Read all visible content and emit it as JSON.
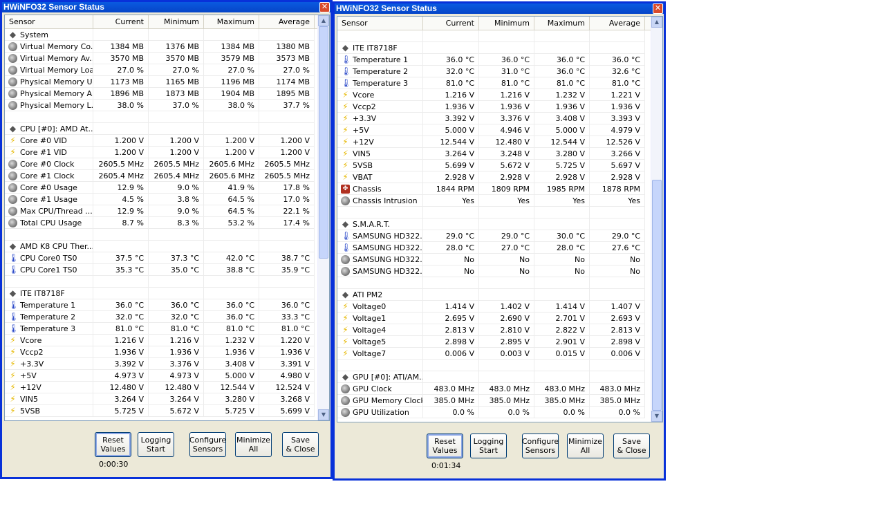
{
  "columns": [
    "Sensor",
    "Current",
    "Minimum",
    "Maximum",
    "Average"
  ],
  "buttons": [
    {
      "line1": "Reset",
      "line2": "Values"
    },
    {
      "line1": "Logging",
      "line2": "Start"
    },
    {
      "line1": "Configure",
      "line2": "Sensors"
    },
    {
      "line1": "Minimize",
      "line2": "All"
    },
    {
      "line1": "Save",
      "line2": "& Close"
    }
  ],
  "windows": [
    {
      "title": "HWiNFO32 Sensor Status",
      "timer": "0:00:30",
      "rows": [
        {
          "icon": "chip",
          "name": "System",
          "vals": [
            "",
            "",
            "",
            ""
          ]
        },
        {
          "icon": "clock",
          "name": "Virtual Memory Co...",
          "vals": [
            "1384 MB",
            "1376 MB",
            "1384 MB",
            "1380 MB"
          ]
        },
        {
          "icon": "clock",
          "name": "Virtual Memory Av...",
          "vals": [
            "3570 MB",
            "3570 MB",
            "3579 MB",
            "3573 MB"
          ]
        },
        {
          "icon": "clock",
          "name": "Virtual Memory Load",
          "vals": [
            "27.0 %",
            "27.0 %",
            "27.0 %",
            "27.0 %"
          ]
        },
        {
          "icon": "clock",
          "name": "Physical Memory U...",
          "vals": [
            "1173 MB",
            "1165 MB",
            "1196 MB",
            "1174 MB"
          ]
        },
        {
          "icon": "clock",
          "name": "Physical Memory A...",
          "vals": [
            "1896 MB",
            "1873 MB",
            "1904 MB",
            "1895 MB"
          ]
        },
        {
          "icon": "clock",
          "name": "Physical Memory L...",
          "vals": [
            "38.0 %",
            "37.0 %",
            "38.0 %",
            "37.7 %"
          ]
        },
        {
          "icon": "",
          "name": "",
          "vals": [
            "",
            "",
            "",
            ""
          ]
        },
        {
          "icon": "chip",
          "name": "CPU [#0]: AMD At...",
          "vals": [
            "",
            "",
            "",
            ""
          ]
        },
        {
          "icon": "volt",
          "name": "Core #0 VID",
          "vals": [
            "1.200 V",
            "1.200 V",
            "1.200 V",
            "1.200 V"
          ]
        },
        {
          "icon": "volt",
          "name": "Core #1 VID",
          "vals": [
            "1.200 V",
            "1.200 V",
            "1.200 V",
            "1.200 V"
          ]
        },
        {
          "icon": "clock",
          "name": "Core #0 Clock",
          "vals": [
            "2605.5 MHz",
            "2605.5 MHz",
            "2605.6 MHz",
            "2605.5 MHz"
          ]
        },
        {
          "icon": "clock",
          "name": "Core #1 Clock",
          "vals": [
            "2605.4 MHz",
            "2605.4 MHz",
            "2605.6 MHz",
            "2605.5 MHz"
          ]
        },
        {
          "icon": "clock",
          "name": "Core #0 Usage",
          "vals": [
            "12.9 %",
            "9.0 %",
            "41.9 %",
            "17.8 %"
          ]
        },
        {
          "icon": "clock",
          "name": "Core #1 Usage",
          "vals": [
            "4.5 %",
            "3.8 %",
            "64.5 %",
            "17.0 %"
          ]
        },
        {
          "icon": "clock",
          "name": "Max CPU/Thread ...",
          "vals": [
            "12.9 %",
            "9.0 %",
            "64.5 %",
            "22.1 %"
          ]
        },
        {
          "icon": "clock",
          "name": "Total CPU Usage",
          "vals": [
            "8.7 %",
            "8.3 %",
            "53.2 %",
            "17.4 %"
          ]
        },
        {
          "icon": "",
          "name": "",
          "vals": [
            "",
            "",
            "",
            ""
          ]
        },
        {
          "icon": "chip",
          "name": "AMD K8 CPU Ther...",
          "vals": [
            "",
            "",
            "",
            ""
          ]
        },
        {
          "icon": "temp",
          "name": "CPU Core0 TS0",
          "vals": [
            "37.5 °C",
            "37.3 °C",
            "42.0 °C",
            "38.7 °C"
          ]
        },
        {
          "icon": "temp",
          "name": "CPU Core1 TS0",
          "vals": [
            "35.3 °C",
            "35.0 °C",
            "38.8 °C",
            "35.9 °C"
          ]
        },
        {
          "icon": "",
          "name": "",
          "vals": [
            "",
            "",
            "",
            ""
          ]
        },
        {
          "icon": "chip",
          "name": "ITE IT8718F",
          "vals": [
            "",
            "",
            "",
            ""
          ]
        },
        {
          "icon": "temp",
          "name": "Temperature 1",
          "vals": [
            "36.0 °C",
            "36.0 °C",
            "36.0 °C",
            "36.0 °C"
          ]
        },
        {
          "icon": "temp",
          "name": "Temperature 2",
          "vals": [
            "32.0 °C",
            "32.0 °C",
            "36.0 °C",
            "33.3 °C"
          ]
        },
        {
          "icon": "temp",
          "name": "Temperature 3",
          "vals": [
            "81.0 °C",
            "81.0 °C",
            "81.0 °C",
            "81.0 °C"
          ]
        },
        {
          "icon": "volt",
          "name": "Vcore",
          "vals": [
            "1.216 V",
            "1.216 V",
            "1.232 V",
            "1.220 V"
          ]
        },
        {
          "icon": "volt",
          "name": "Vccp2",
          "vals": [
            "1.936 V",
            "1.936 V",
            "1.936 V",
            "1.936 V"
          ]
        },
        {
          "icon": "volt",
          "name": "+3.3V",
          "vals": [
            "3.392 V",
            "3.376 V",
            "3.408 V",
            "3.391 V"
          ]
        },
        {
          "icon": "volt",
          "name": "+5V",
          "vals": [
            "4.973 V",
            "4.973 V",
            "5.000 V",
            "4.980 V"
          ]
        },
        {
          "icon": "volt",
          "name": "+12V",
          "vals": [
            "12.480 V",
            "12.480 V",
            "12.544 V",
            "12.524 V"
          ]
        },
        {
          "icon": "volt",
          "name": "VIN5",
          "vals": [
            "3.264 V",
            "3.264 V",
            "3.280 V",
            "3.268 V"
          ]
        },
        {
          "icon": "volt",
          "name": "5VSB",
          "vals": [
            "5.725 V",
            "5.672 V",
            "5.725 V",
            "5.699 V"
          ]
        }
      ]
    },
    {
      "title": "HWiNFO32 Sensor Status",
      "timer": "0:01:34",
      "rows": [
        {
          "icon": "",
          "name": "",
          "vals": [
            "",
            "",
            "",
            ""
          ]
        },
        {
          "icon": "chip",
          "name": "ITE IT8718F",
          "vals": [
            "",
            "",
            "",
            ""
          ]
        },
        {
          "icon": "temp",
          "name": "Temperature 1",
          "vals": [
            "36.0 °C",
            "36.0 °C",
            "36.0 °C",
            "36.0 °C"
          ]
        },
        {
          "icon": "temp",
          "name": "Temperature 2",
          "vals": [
            "32.0 °C",
            "31.0 °C",
            "36.0 °C",
            "32.6 °C"
          ]
        },
        {
          "icon": "temp",
          "name": "Temperature 3",
          "vals": [
            "81.0 °C",
            "81.0 °C",
            "81.0 °C",
            "81.0 °C"
          ]
        },
        {
          "icon": "volt",
          "name": "Vcore",
          "vals": [
            "1.216 V",
            "1.216 V",
            "1.232 V",
            "1.221 V"
          ]
        },
        {
          "icon": "volt",
          "name": "Vccp2",
          "vals": [
            "1.936 V",
            "1.936 V",
            "1.936 V",
            "1.936 V"
          ]
        },
        {
          "icon": "volt",
          "name": "+3.3V",
          "vals": [
            "3.392 V",
            "3.376 V",
            "3.408 V",
            "3.393 V"
          ]
        },
        {
          "icon": "volt",
          "name": "+5V",
          "vals": [
            "5.000 V",
            "4.946 V",
            "5.000 V",
            "4.979 V"
          ]
        },
        {
          "icon": "volt",
          "name": "+12V",
          "vals": [
            "12.544 V",
            "12.480 V",
            "12.544 V",
            "12.526 V"
          ]
        },
        {
          "icon": "volt",
          "name": "VIN5",
          "vals": [
            "3.264 V",
            "3.248 V",
            "3.280 V",
            "3.266 V"
          ]
        },
        {
          "icon": "volt",
          "name": "5VSB",
          "vals": [
            "5.699 V",
            "5.672 V",
            "5.725 V",
            "5.697 V"
          ]
        },
        {
          "icon": "volt",
          "name": "VBAT",
          "vals": [
            "2.928 V",
            "2.928 V",
            "2.928 V",
            "2.928 V"
          ]
        },
        {
          "icon": "fan",
          "name": "Chassis",
          "vals": [
            "1844 RPM",
            "1809 RPM",
            "1985 RPM",
            "1878 RPM"
          ]
        },
        {
          "icon": "clock",
          "name": "Chassis Intrusion",
          "vals": [
            "Yes",
            "Yes",
            "Yes",
            "Yes"
          ]
        },
        {
          "icon": "",
          "name": "",
          "vals": [
            "",
            "",
            "",
            ""
          ]
        },
        {
          "icon": "chip",
          "name": "S.M.A.R.T.",
          "vals": [
            "",
            "",
            "",
            ""
          ]
        },
        {
          "icon": "temp",
          "name": "SAMSUNG HD322...",
          "vals": [
            "29.0 °C",
            "29.0 °C",
            "30.0 °C",
            "29.0 °C"
          ]
        },
        {
          "icon": "temp",
          "name": "SAMSUNG HD322...",
          "vals": [
            "28.0 °C",
            "27.0 °C",
            "28.0 °C",
            "27.6 °C"
          ]
        },
        {
          "icon": "clock",
          "name": "SAMSUNG HD322...",
          "vals": [
            "No",
            "No",
            "No",
            "No"
          ]
        },
        {
          "icon": "clock",
          "name": "SAMSUNG HD322...",
          "vals": [
            "No",
            "No",
            "No",
            "No"
          ]
        },
        {
          "icon": "",
          "name": "",
          "vals": [
            "",
            "",
            "",
            ""
          ]
        },
        {
          "icon": "chip",
          "name": "ATI PM2",
          "vals": [
            "",
            "",
            "",
            ""
          ]
        },
        {
          "icon": "volt",
          "name": "Voltage0",
          "vals": [
            "1.414 V",
            "1.402 V",
            "1.414 V",
            "1.407 V"
          ]
        },
        {
          "icon": "volt",
          "name": "Voltage1",
          "vals": [
            "2.695 V",
            "2.690 V",
            "2.701 V",
            "2.693 V"
          ]
        },
        {
          "icon": "volt",
          "name": "Voltage4",
          "vals": [
            "2.813 V",
            "2.810 V",
            "2.822 V",
            "2.813 V"
          ]
        },
        {
          "icon": "volt",
          "name": "Voltage5",
          "vals": [
            "2.898 V",
            "2.895 V",
            "2.901 V",
            "2.898 V"
          ]
        },
        {
          "icon": "volt",
          "name": "Voltage7",
          "vals": [
            "0.006 V",
            "0.003 V",
            "0.015 V",
            "0.006 V"
          ]
        },
        {
          "icon": "",
          "name": "",
          "vals": [
            "",
            "",
            "",
            ""
          ]
        },
        {
          "icon": "chip",
          "name": "GPU [#0]: ATI/AM...",
          "vals": [
            "",
            "",
            "",
            ""
          ]
        },
        {
          "icon": "clock",
          "name": "GPU Clock",
          "vals": [
            "483.0 MHz",
            "483.0 MHz",
            "483.0 MHz",
            "483.0 MHz"
          ]
        },
        {
          "icon": "clock",
          "name": "GPU Memory Clock",
          "vals": [
            "385.0 MHz",
            "385.0 MHz",
            "385.0 MHz",
            "385.0 MHz"
          ]
        },
        {
          "icon": "clock",
          "name": "GPU Utilization",
          "vals": [
            "0.0 %",
            "0.0 %",
            "0.0 %",
            "0.0 %"
          ]
        }
      ]
    }
  ],
  "icons": {
    "close": "close-icon",
    "clock": "gauge-icon",
    "temp": "thermometer-icon",
    "volt": "lightning-icon",
    "fan": "fan-icon",
    "chip": "chip-icon"
  }
}
